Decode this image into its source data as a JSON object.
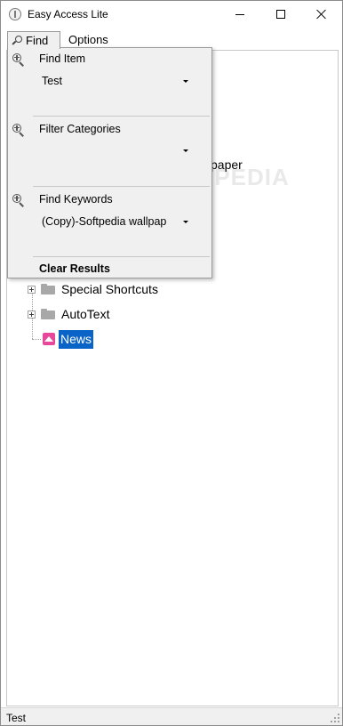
{
  "window": {
    "title": "Easy Access Lite",
    "controls": {
      "minimize": "minimize",
      "maximize": "maximize",
      "close": "close"
    }
  },
  "menu": {
    "find_label": "Find",
    "options_label": "Options"
  },
  "find_panel": {
    "find_item": {
      "title": "Find Item",
      "value": "Test"
    },
    "filter_categories": {
      "title": "Filter Categories",
      "value": ""
    },
    "find_keywords": {
      "title": "Find Keywords",
      "value": "(Copy)-Softpedia wallpap"
    },
    "clear_results_label": "Clear Results"
  },
  "tree": {
    "watermark": "SOFTPEDIA",
    "partial_item_text": "paper",
    "items": [
      {
        "label": "Special Shortcuts",
        "icon": "folder-icon"
      },
      {
        "label": "AutoText",
        "icon": "folder-icon"
      },
      {
        "label": "News",
        "icon": "image-icon",
        "selected": true
      }
    ]
  },
  "status": {
    "text": "Test"
  },
  "colors": {
    "selection": "#0a64c8",
    "panel_bg": "#f0f0f0",
    "news_icon": "#e8489a",
    "folder_icon": "#a8a8a8"
  }
}
